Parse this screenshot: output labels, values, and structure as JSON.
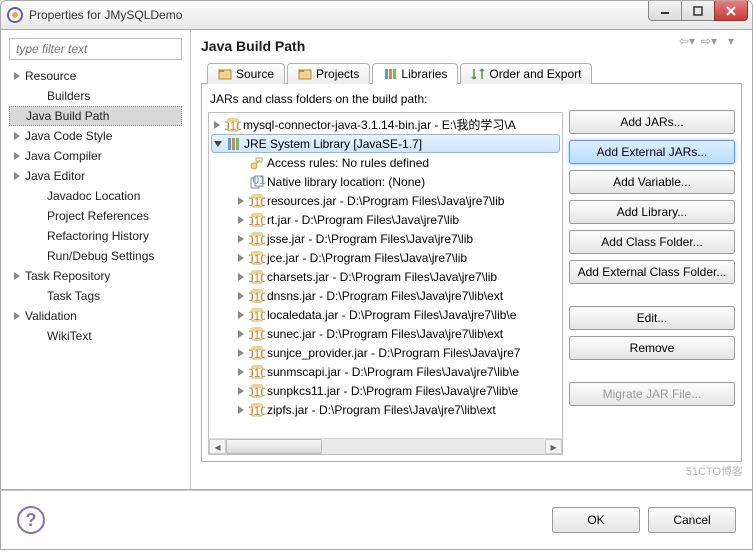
{
  "window": {
    "title": "Properties for JMySQLDemo"
  },
  "filter_placeholder": "type filter text",
  "left_tree": [
    {
      "label": "Resource",
      "expandable": true
    },
    {
      "label": "Builders"
    },
    {
      "label": "Java Build Path",
      "selected": true
    },
    {
      "label": "Java Code Style",
      "expandable": true
    },
    {
      "label": "Java Compiler",
      "expandable": true
    },
    {
      "label": "Java Editor",
      "expandable": true
    },
    {
      "label": "Javadoc Location"
    },
    {
      "label": "Project References"
    },
    {
      "label": "Refactoring History"
    },
    {
      "label": "Run/Debug Settings"
    },
    {
      "label": "Task Repository",
      "expandable": true
    },
    {
      "label": "Task Tags"
    },
    {
      "label": "Validation",
      "expandable": true
    },
    {
      "label": "WikiText"
    }
  ],
  "section_title": "Java Build Path",
  "tabs": [
    {
      "label": "Source",
      "icon": "source-folder"
    },
    {
      "label": "Projects",
      "icon": "projects-folder"
    },
    {
      "label": "Libraries",
      "icon": "library",
      "active": true
    },
    {
      "label": "Order and Export",
      "icon": "order"
    }
  ],
  "list_desc": "JARs and class folders on the build path:",
  "items": [
    {
      "kind": "jar",
      "expand": "closed",
      "label": "mysql-connector-java-3.1.14-bin.jar - E:\\我的学习\\A"
    },
    {
      "kind": "lib",
      "expand": "open",
      "label": "JRE System Library [JavaSE-1.7]",
      "selected": true
    },
    {
      "kind": "access",
      "sub": true,
      "label": "Access rules: No rules defined"
    },
    {
      "kind": "native",
      "sub": true,
      "label": "Native library location: (None)"
    },
    {
      "kind": "jar",
      "sub": true,
      "expand": "closed",
      "label": "resources.jar - D:\\Program Files\\Java\\jre7\\lib"
    },
    {
      "kind": "jar",
      "sub": true,
      "expand": "closed",
      "label": "rt.jar - D:\\Program Files\\Java\\jre7\\lib"
    },
    {
      "kind": "jar",
      "sub": true,
      "expand": "closed",
      "label": "jsse.jar - D:\\Program Files\\Java\\jre7\\lib"
    },
    {
      "kind": "jar",
      "sub": true,
      "expand": "closed",
      "label": "jce.jar - D:\\Program Files\\Java\\jre7\\lib"
    },
    {
      "kind": "jar",
      "sub": true,
      "expand": "closed",
      "label": "charsets.jar - D:\\Program Files\\Java\\jre7\\lib"
    },
    {
      "kind": "jar",
      "sub": true,
      "expand": "closed",
      "label": "dnsns.jar - D:\\Program Files\\Java\\jre7\\lib\\ext"
    },
    {
      "kind": "jar",
      "sub": true,
      "expand": "closed",
      "label": "localedata.jar - D:\\Program Files\\Java\\jre7\\lib\\e"
    },
    {
      "kind": "jar",
      "sub": true,
      "expand": "closed",
      "label": "sunec.jar - D:\\Program Files\\Java\\jre7\\lib\\ext"
    },
    {
      "kind": "jar",
      "sub": true,
      "expand": "closed",
      "label": "sunjce_provider.jar - D:\\Program Files\\Java\\jre7"
    },
    {
      "kind": "jar",
      "sub": true,
      "expand": "closed",
      "label": "sunmscapi.jar - D:\\Program Files\\Java\\jre7\\lib\\e"
    },
    {
      "kind": "jar",
      "sub": true,
      "expand": "closed",
      "label": "sunpkcs11.jar - D:\\Program Files\\Java\\jre7\\lib\\e"
    },
    {
      "kind": "jar",
      "sub": true,
      "expand": "closed",
      "label": "zipfs.jar - D:\\Program Files\\Java\\jre7\\lib\\ext"
    }
  ],
  "buttons": {
    "add_jars": "Add JARs...",
    "add_ext_jars": "Add External JARs...",
    "add_var": "Add Variable...",
    "add_lib": "Add Library...",
    "add_cf": "Add Class Folder...",
    "add_ext_cf": "Add External Class Folder...",
    "edit": "Edit...",
    "remove": "Remove",
    "migrate": "Migrate JAR File..."
  },
  "footer": {
    "ok": "OK",
    "cancel": "Cancel"
  },
  "watermark": "51CTO博客"
}
